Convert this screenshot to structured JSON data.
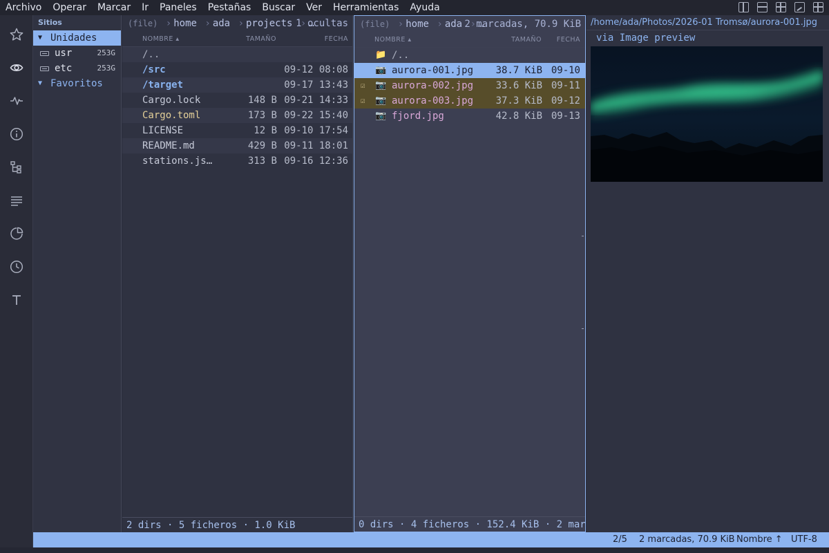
{
  "menubar": {
    "items": [
      "Archivo",
      "Operar",
      "Marcar",
      "Ir",
      "Paneles",
      "Pestañas",
      "Buscar",
      "Ver",
      "Herramientas",
      "Ayuda"
    ],
    "layout_icons": [
      "layout-split-vertical-icon",
      "layout-split-horizontal-icon",
      "layout-grid-icon",
      "layout-preview-icon",
      "layout-quad-icon"
    ]
  },
  "activitybar": {
    "icons": [
      "star-icon",
      "eye-icon",
      "activity-icon",
      "info-icon",
      "tree-icon",
      "list-icon",
      "pie-chart-icon",
      "clock-icon",
      "text-icon"
    ]
  },
  "sidebar": {
    "header": "Sitios",
    "section_drives": "Unidades",
    "drives": [
      {
        "name": "usr",
        "size": "253G"
      },
      {
        "name": "etc",
        "size": "253G"
      }
    ],
    "section_favorites": "Favoritos"
  },
  "left_panel": {
    "scheme": "(file)",
    "path": [
      "home",
      "ada",
      "projects",
      "…"
    ],
    "info": "1 ocultas",
    "columns": {
      "name": "NOMBRE ▴",
      "size": "TAMAÑO",
      "date": "FECHA"
    },
    "rows": [
      {
        "name": "/..",
        "size": "",
        "date": "",
        "kind": "up"
      },
      {
        "name": "/src",
        "size": "",
        "date": "09-12 08:08",
        "kind": "dir"
      },
      {
        "name": "/target",
        "size": "",
        "date": "09-17 13:43",
        "kind": "dir"
      },
      {
        "name": "Cargo.lock",
        "size": "148 B",
        "date": "09-21 14:33",
        "kind": "file"
      },
      {
        "name": "Cargo.toml",
        "size": "173 B",
        "date": "09-22 15:40",
        "kind": "toml"
      },
      {
        "name": "LICENSE",
        "size": "12 B",
        "date": "09-10 17:54",
        "kind": "file"
      },
      {
        "name": "README.md",
        "size": "429 B",
        "date": "09-11 18:01",
        "kind": "file"
      },
      {
        "name": "stations.js…",
        "size": "313 B",
        "date": "09-16 12:36",
        "kind": "file"
      }
    ],
    "footer": "2 dirs · 5 ficheros · 1.0 KiB"
  },
  "right_panel": {
    "scheme": "(file)",
    "path": [
      "home",
      "ada",
      "…"
    ],
    "info": "2 marcadas, 70.9 KiB",
    "columns": {
      "name": "NOMBRE ▴",
      "size": "TAMAÑO",
      "date": "FECHA"
    },
    "rows": [
      {
        "name": "/..",
        "size": "",
        "date": "",
        "kind": "up",
        "icon": "📁",
        "mark": ""
      },
      {
        "name": "aurora-001.jpg",
        "size": "38.7 KiB",
        "date": "09-10",
        "kind": "selected",
        "icon": "📷",
        "mark": ""
      },
      {
        "name": "aurora-002.jpg",
        "size": "33.6 KiB",
        "date": "09-11",
        "kind": "marked",
        "icon": "📷",
        "mark": "☑"
      },
      {
        "name": "aurora-003.jpg",
        "size": "37.3 KiB",
        "date": "09-12",
        "kind": "marked",
        "icon": "📷",
        "mark": "☑"
      },
      {
        "name": "fjord.jpg",
        "size": "42.8 KiB",
        "date": "09-13",
        "kind": "img",
        "icon": "📷",
        "mark": ""
      }
    ],
    "footer": "0 dirs · 4 ficheros · 152.4 KiB · 2 mar…"
  },
  "preview": {
    "path": "/home/ada/Photos/2026-01 Tromsø/aurora-001.jpg",
    "via": "via Image preview",
    "colors": {
      "sky": "#07101c",
      "aurora": "#2fc48a",
      "ground": "#03080e"
    }
  },
  "statusbar": {
    "position": "2/5",
    "marked": "2 marcadas, 70.9 KiB",
    "sort": "Nombre ↑",
    "encoding": "UTF-8"
  },
  "colors": {
    "accent": "#8db4f0",
    "marked_bg": "#574d2a",
    "directory": "#89b3ef",
    "image_file": "#d9a8d8",
    "toml_file": "#e3cf98"
  }
}
